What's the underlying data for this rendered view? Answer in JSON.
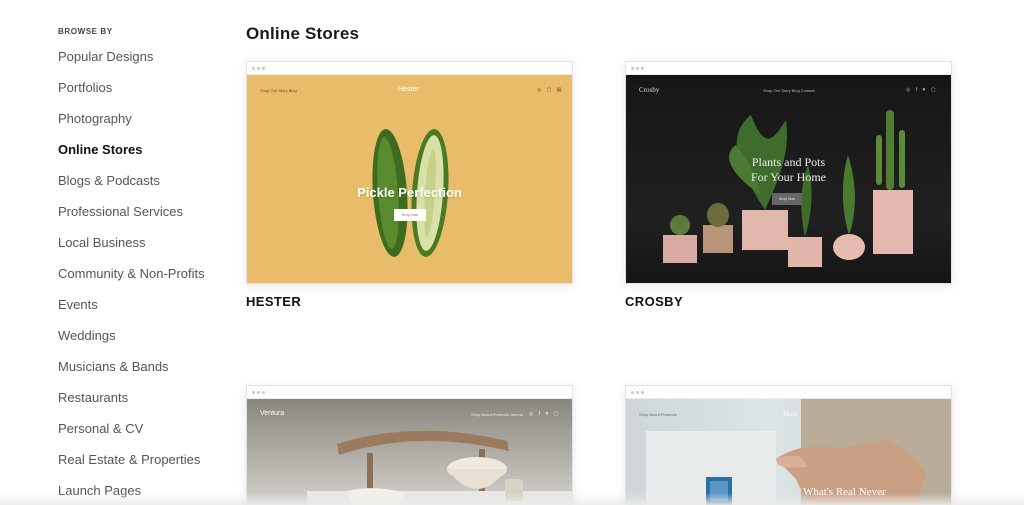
{
  "sidebar": {
    "heading": "BROWSE BY",
    "items": [
      {
        "label": "Popular Designs"
      },
      {
        "label": "Portfolios"
      },
      {
        "label": "Photography"
      },
      {
        "label": "Online Stores"
      },
      {
        "label": "Blogs & Podcasts"
      },
      {
        "label": "Professional Services"
      },
      {
        "label": "Local Business"
      },
      {
        "label": "Community & Non-Profits"
      },
      {
        "label": "Events"
      },
      {
        "label": "Weddings"
      },
      {
        "label": "Musicians & Bands"
      },
      {
        "label": "Restaurants"
      },
      {
        "label": "Personal & CV"
      },
      {
        "label": "Real Estate & Properties"
      },
      {
        "label": "Launch Pages"
      }
    ],
    "active_item": "Online Stores"
  },
  "main": {
    "section_title": "Online Stores",
    "templates": [
      {
        "name": "HESTER",
        "preview": {
          "brand": "Hester",
          "nav": "Shop  Our Story  Blog",
          "icons": "◎ ▢ ▤",
          "headline": "Pickle Perfection",
          "button": "Shop Now",
          "bg_color": "#e8bc68"
        }
      },
      {
        "name": "CROSBY",
        "preview": {
          "brand": "Crosby",
          "nav": "Shop  Our Story  Blog  Contact",
          "icons": "◎ f ♥ ▢",
          "headline_line1": "Plants and Pots",
          "headline_line2": "For Your Home",
          "button": "Shop Now",
          "bg_color": "#1c1c1c"
        }
      },
      {
        "name": "",
        "preview": {
          "brand": "Ventura",
          "nav": "Shop  About  Products  Journal",
          "icons": "◎ f ♥ ▢"
        }
      },
      {
        "name": "",
        "preview": {
          "brand": "Mara",
          "nav": "Shop  About  Products",
          "headline": "What's Real Never"
        }
      }
    ]
  },
  "colors": {
    "active_nav": "#111111",
    "nav": "#555555",
    "hester_yellow": "#e8bc68",
    "crosby_dark": "#1c1c1c"
  }
}
